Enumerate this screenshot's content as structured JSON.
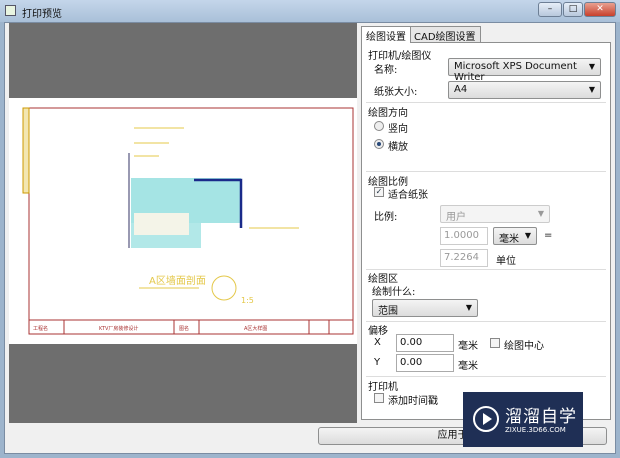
{
  "window": {
    "title": "打印预览",
    "minimize": "–",
    "maximize": "□",
    "close": "✕"
  },
  "drawing": {
    "title": "A区墙面剖面",
    "scale": "1:5",
    "project_label": "工程名",
    "project": "KTV厂房装修设计",
    "name_label": "图名",
    "name": "A区大样图"
  },
  "tabs": [
    {
      "label": "绘图设置"
    },
    {
      "label": "CAD绘图设置"
    }
  ],
  "printer": {
    "section": "打印机/绘图仪",
    "name_label": "名称:",
    "name_value": "Microsoft XPS Document Writer",
    "paper_label": "纸张大小:",
    "paper_value": "A4"
  },
  "orientation": {
    "section": "绘图方向",
    "portrait": "竖向",
    "landscape": "横放",
    "selected": "landscape"
  },
  "scale": {
    "section": "绘图比例",
    "fit_label": "适合纸张",
    "fit_checked": true,
    "ratio_label": "比例:",
    "ratio_value": "用户",
    "value1": "1.0000",
    "unit": "毫米",
    "equals": "=",
    "value2": "7.2264",
    "unit2": "单位"
  },
  "area": {
    "section": "绘图区",
    "what_label": "绘制什么:",
    "what_value": "范围"
  },
  "offset": {
    "section": "偏移",
    "x_label": "X",
    "x_value": "0.00",
    "x_unit": "毫米",
    "center_label": "绘图中心",
    "y_label": "Y",
    "y_value": "0.00",
    "y_unit": "毫米"
  },
  "plotter": {
    "section": "打印机",
    "timestamp_label": "添加时间戳"
  },
  "apply_button": "应用于布局",
  "watermark": {
    "name": "溜溜自学",
    "url": "ZIXUE.3D66.COM"
  }
}
